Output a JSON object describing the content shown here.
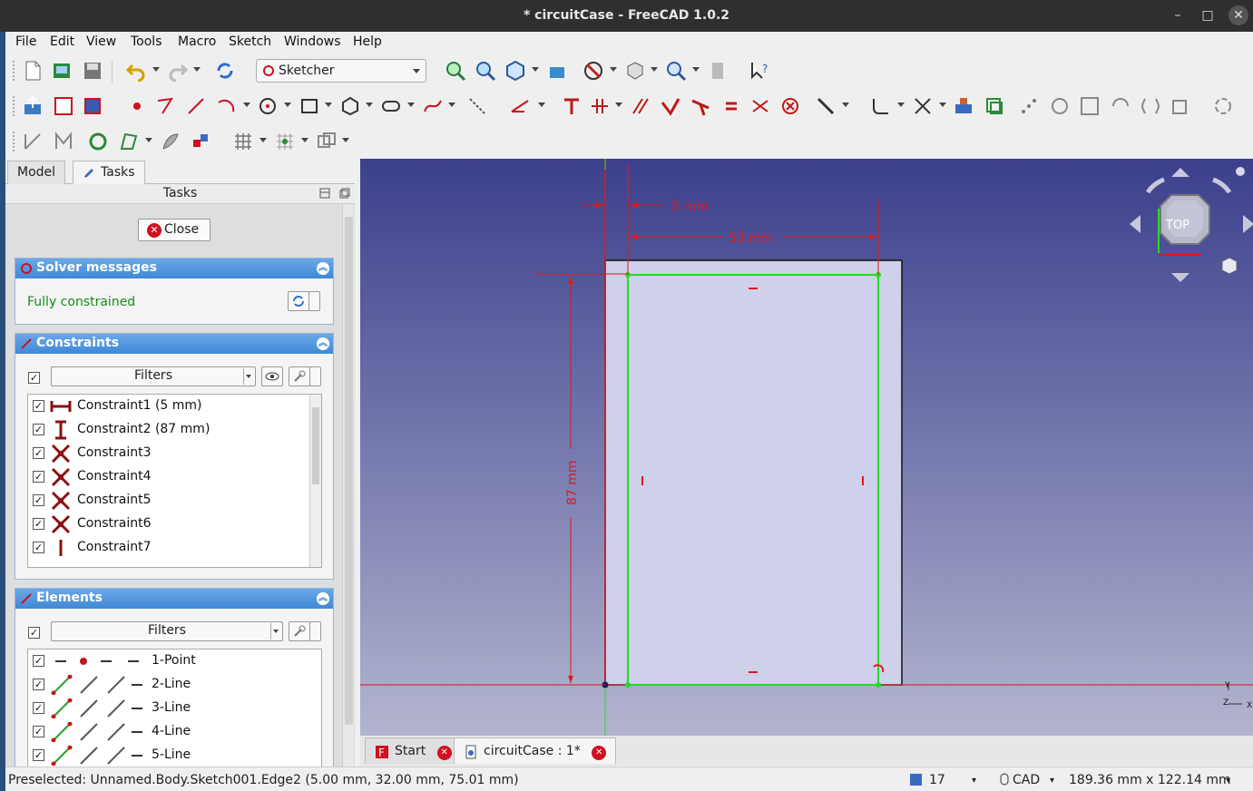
{
  "window": {
    "title": "* circuitCase - FreeCAD 1.0.2",
    "minimize": "–",
    "maximize": "□",
    "close": "✕"
  },
  "menu": [
    "File",
    "Edit",
    "View",
    "Tools",
    "Macro",
    "Sketch",
    "Windows",
    "Help"
  ],
  "workbench": {
    "selected": "Sketcher"
  },
  "left_tabs": {
    "model": "Model",
    "tasks": "Tasks"
  },
  "tasks_panel": {
    "title": "Tasks",
    "close_label": "Close",
    "solver": {
      "title": "Solver messages",
      "status": "Fully constrained",
      "status_color": "#1a8a1a"
    },
    "constraints": {
      "title": "Constraints",
      "filters_label": "Filters",
      "items": [
        {
          "label": "Constraint1 (5 mm)",
          "icon": "horizontal-distance-icon"
        },
        {
          "label": "Constraint2 (87 mm)",
          "icon": "vertical-distance-icon"
        },
        {
          "label": "Constraint3",
          "icon": "coincident-icon"
        },
        {
          "label": "Constraint4",
          "icon": "coincident-icon"
        },
        {
          "label": "Constraint5",
          "icon": "coincident-icon"
        },
        {
          "label": "Constraint6",
          "icon": "coincident-icon"
        },
        {
          "label": "Constraint7",
          "icon": "vertical-icon"
        }
      ]
    },
    "elements": {
      "title": "Elements",
      "filters_label": "Filters",
      "items": [
        {
          "label": "1-Point",
          "icon": "point-icon"
        },
        {
          "label": "2-Line",
          "icon": "line-icon"
        },
        {
          "label": "3-Line",
          "icon": "line-icon"
        },
        {
          "label": "4-Line",
          "icon": "line-icon"
        },
        {
          "label": "5-Line",
          "icon": "line-icon"
        }
      ]
    }
  },
  "viewport": {
    "dimensions": {
      "horizontal_small": "5 mm",
      "horizontal_large": "53 mm",
      "vertical": "87 mm"
    },
    "navcube_face": "TOP",
    "axis_y": "Y",
    "axis_z": "Z",
    "axis_x": "X",
    "constraint_color": "#e01818",
    "line_color": "#22dd22"
  },
  "doc_tabs": [
    {
      "label": "Start",
      "icon": "freecad-icon"
    },
    {
      "label": "circuitCase : 1*",
      "icon": "document-icon"
    }
  ],
  "status": {
    "preselected": "Preselected: Unnamed.Body.Sketch001.Edge2 (5.00 mm, 32.00 mm, 75.01 mm)",
    "count": "17",
    "nav_style": "CAD",
    "dimensions": "189.36 mm x 122.14 mm"
  },
  "colors": {
    "header_blue": "#4a90dc",
    "close_red": "#d01020"
  }
}
